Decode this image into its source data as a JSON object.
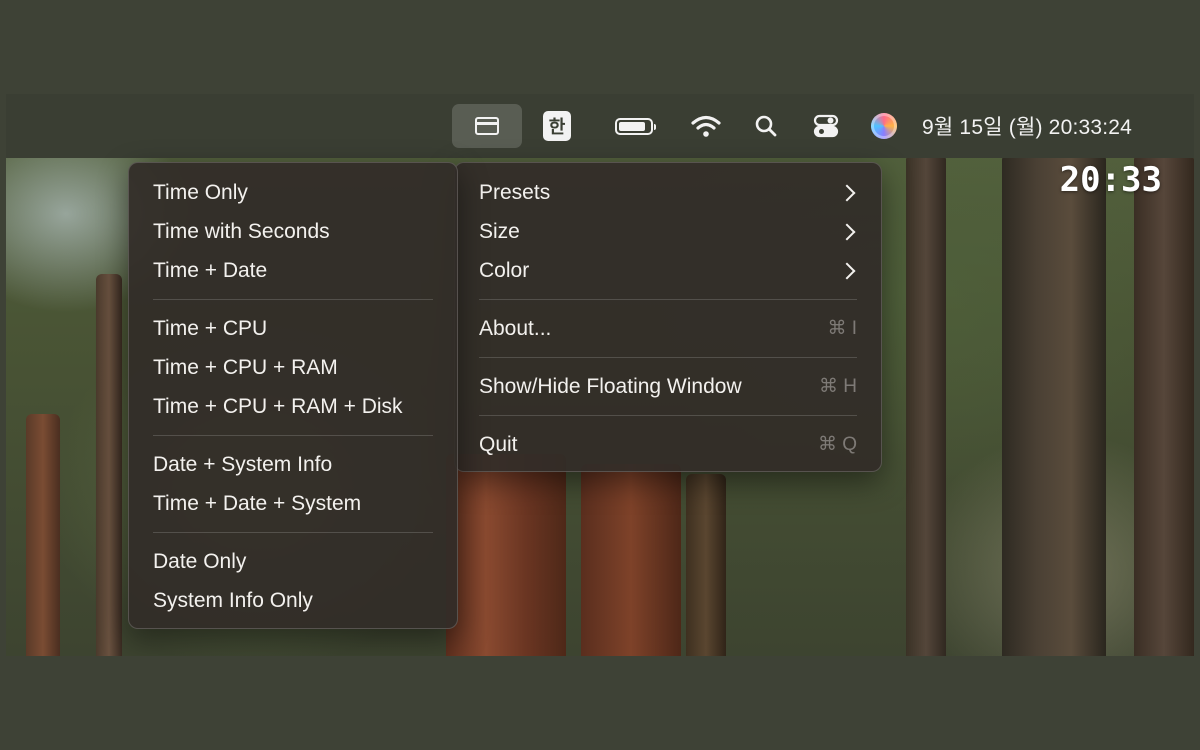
{
  "menubar": {
    "app_icon": "floating-window-icon",
    "input_method": "한",
    "battery_level": 0.85,
    "wifi_icon": "wifi-icon",
    "search_icon": "search-icon",
    "control_center_icon": "control-center-icon",
    "siri_icon": "siri-icon",
    "clock": "9월 15일 (월) 20:33:24"
  },
  "floating_window": {
    "time": "20:33"
  },
  "main_menu": {
    "items": [
      {
        "label": "Presets",
        "submenu": true
      },
      {
        "label": "Size",
        "submenu": true
      },
      {
        "label": "Color",
        "submenu": true
      },
      {
        "label": "About...",
        "shortcut": "⌘ I"
      },
      {
        "label": "Show/Hide Floating Window",
        "shortcut": "⌘ H"
      },
      {
        "label": "Quit",
        "shortcut": "⌘ Q"
      }
    ]
  },
  "presets_menu": {
    "items": [
      {
        "label": "Time Only"
      },
      {
        "label": "Time with Seconds"
      },
      {
        "label": "Time + Date"
      },
      {
        "label": "Time + CPU"
      },
      {
        "label": "Time + CPU + RAM"
      },
      {
        "label": "Time + CPU + RAM + Disk"
      },
      {
        "label": "Date + System Info"
      },
      {
        "label": "Time + Date + System"
      },
      {
        "label": "Date Only"
      },
      {
        "label": "System Info Only"
      }
    ]
  }
}
